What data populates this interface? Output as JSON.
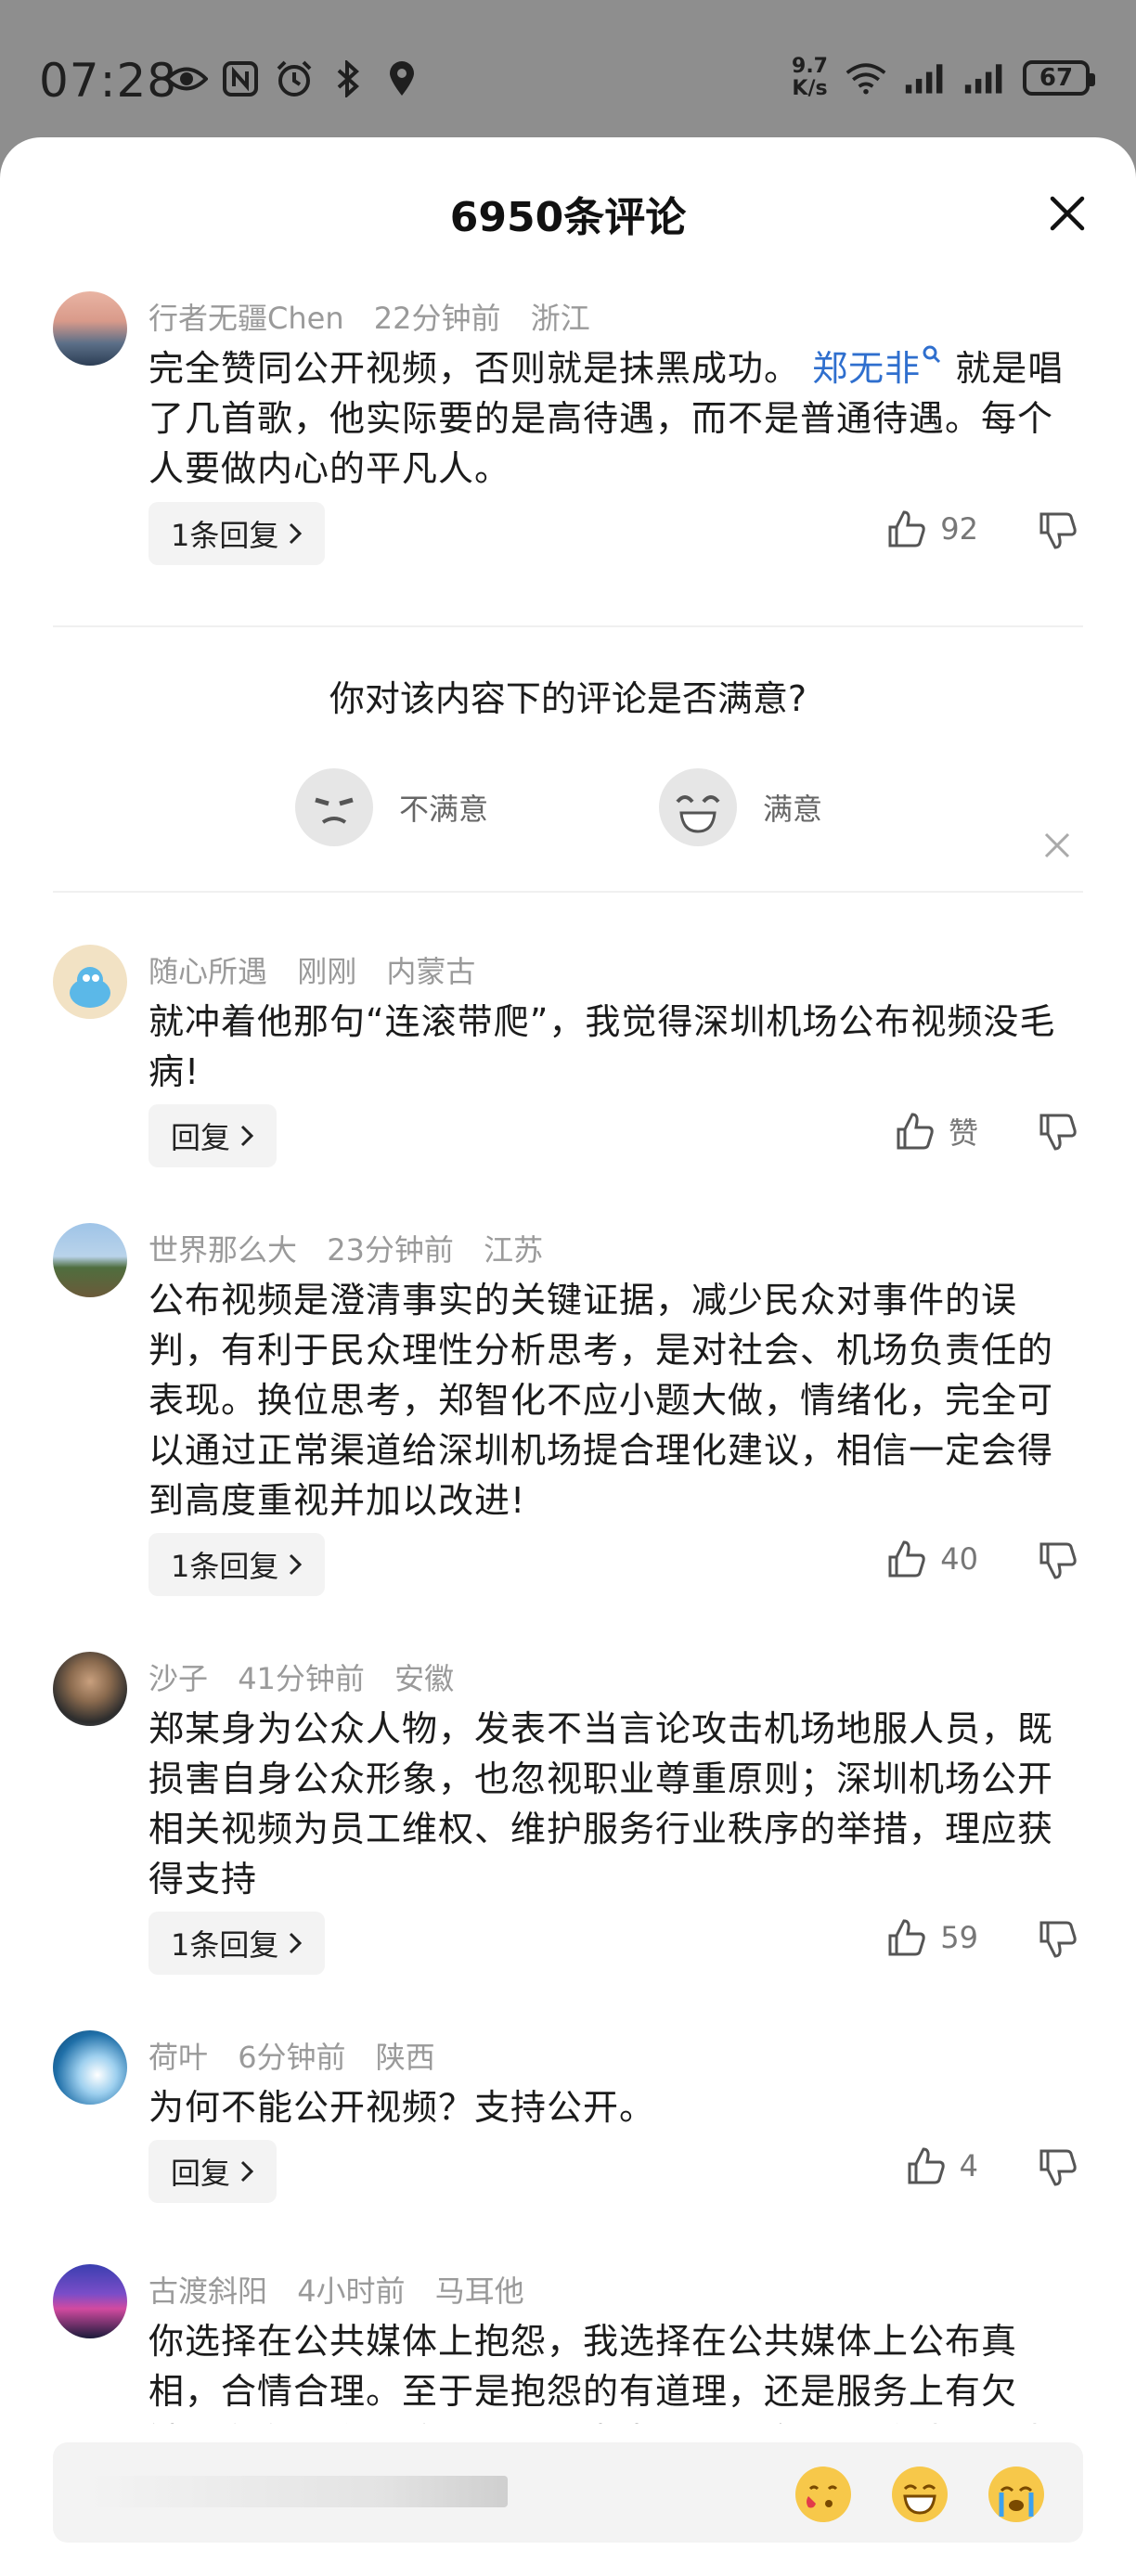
{
  "status_bar": {
    "time": "07:28",
    "net_speed_value": "9.7",
    "net_speed_unit": "K/s",
    "battery": "67"
  },
  "sheet": {
    "title": "6950条评论"
  },
  "comments": [
    {
      "user": "行者无疆Chen",
      "time": "22分钟前",
      "location": "浙江",
      "text_before": "完全赞同公开视频，否则就是抹黑成功。",
      "mention": "郑无非",
      "text_after": " 就是唱了几首歌，他实际要的是高待遇，而不是普通待遇。每个人要做内心的平凡人。",
      "reply_label": "1条回复",
      "likes": "92"
    },
    {
      "user": "随心所遇",
      "time": "刚刚",
      "location": "内蒙古",
      "text": "就冲着他那句“连滚带爬”，我觉得深圳机场公布视频没毛病!",
      "reply_label": "回复",
      "likes": "赞"
    },
    {
      "user": "世界那么大",
      "time": "23分钟前",
      "location": "江苏",
      "text": "公布视频是澄清事实的关键证据，减少民众对事件的误判，有利于民众理性分析思考，是对社会、机场负责任的表现。换位思考，郑智化不应小题大做，情绪化，完全可以通过正常渠道给深圳机场提合理化建议，相信一定会得到高度重视并加以改进!",
      "reply_label": "1条回复",
      "likes": "40"
    },
    {
      "user": "沙子",
      "time": "41分钟前",
      "location": "安徽",
      "text": "郑某身为公众人物，发表不当言论攻击机场地服人员，既损害自身公众形象，也忽视职业尊重原则；深圳机场公开相关视频为员工维权、维护服务行业秩序的举措，理应获得支持",
      "reply_label": "1条回复",
      "likes": "59"
    },
    {
      "user": "荷叶",
      "time": "6分钟前",
      "location": "陕西",
      "text": "为何不能公开视频？支持公开。",
      "reply_label": "回复",
      "likes": "4"
    },
    {
      "user": "古渡斜阳",
      "time": "4小时前",
      "location": "马耳他",
      "text": "你选择在公共媒体上抱怨，我选择在公共媒体上公布真相，合情合理。至于是抱怨的有道理，还是服务上有欠缺，在存公众评论，不要郑先生是什么身份，做过什么事",
      "reply_label": "",
      "likes": ""
    }
  ],
  "survey": {
    "question": "你对该内容下的评论是否满意?",
    "option_bad": "不满意",
    "option_good": "满意"
  },
  "colors": {
    "mention": "#2f6fce",
    "sheet_bg": "#ffffff",
    "overlay": "#8e8e8e"
  }
}
